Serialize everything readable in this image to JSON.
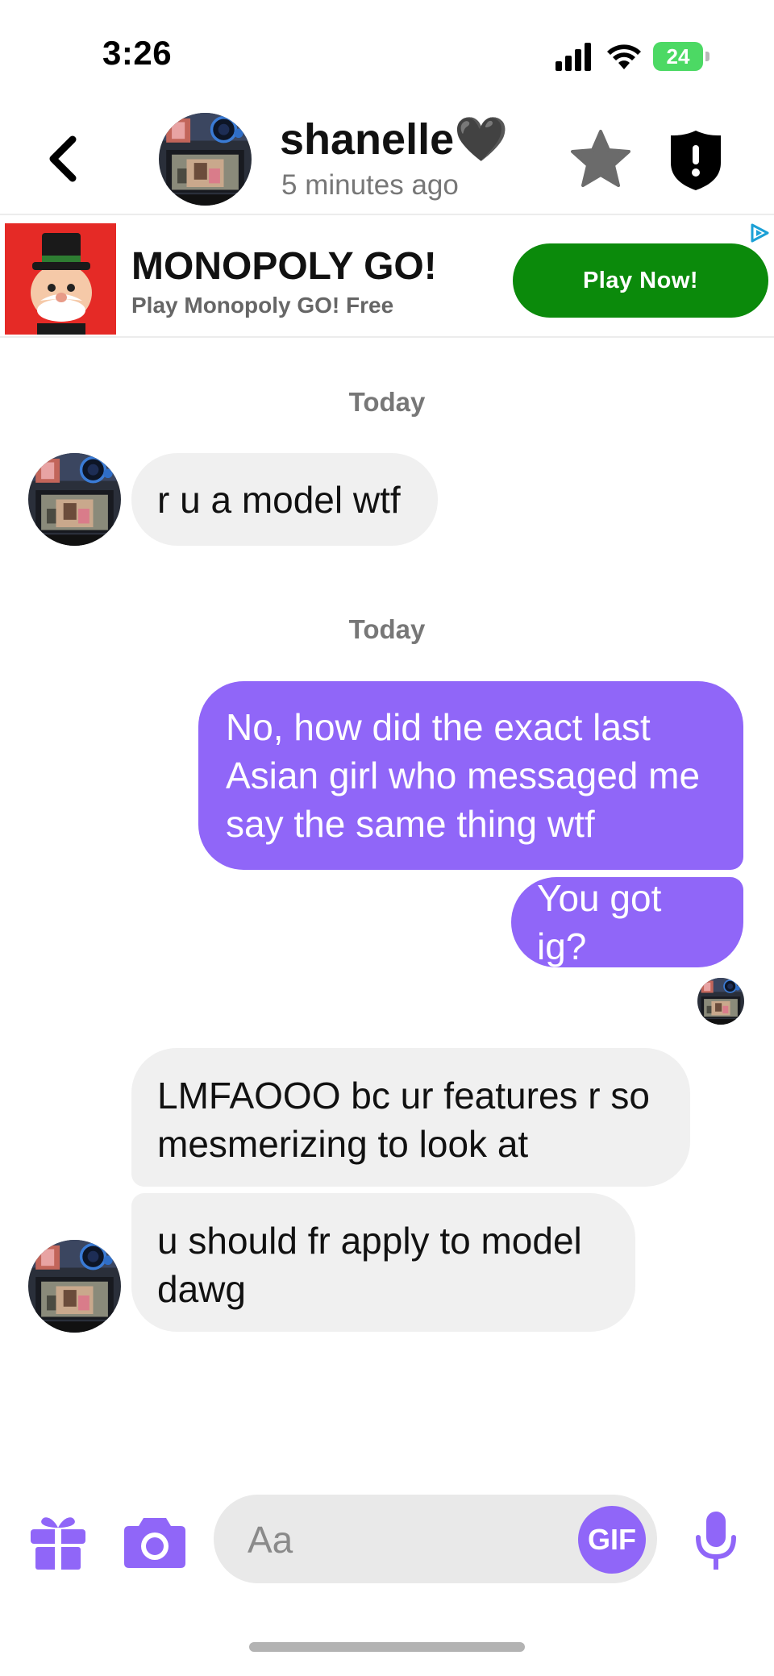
{
  "status_bar": {
    "time": "3:26",
    "battery": "24"
  },
  "header": {
    "contact_name": "shanelle🖤",
    "last_seen": "5 minutes ago"
  },
  "ad": {
    "title": "MONOPOLY GO!",
    "subtitle": "Play Monopoly GO! Free",
    "cta": "Play Now!"
  },
  "chat": {
    "day_labels": [
      "Today",
      "Today"
    ],
    "messages": [
      {
        "direction": "incoming",
        "text": "r u a model wtf"
      },
      {
        "direction": "outgoing",
        "text": "No, how did the exact last Asian girl who messaged me say the same thing wtf"
      },
      {
        "direction": "outgoing",
        "text": "You got ig?"
      },
      {
        "direction": "incoming",
        "text": "LMFAOOO bc ur features r so mesmerizing to look at"
      },
      {
        "direction": "incoming",
        "text": "u should fr apply to model dawg"
      }
    ]
  },
  "composer": {
    "placeholder": "Aa",
    "gif_label": "GIF"
  },
  "colors": {
    "accent": "#9066f8",
    "incoming_bubble": "#f0f0f0",
    "ad_cta": "#0b8a0b",
    "battery": "#4cd964"
  },
  "icons": [
    "back-chevron-icon",
    "star-icon",
    "shield-icon",
    "ad-choices-icon",
    "gift-icon",
    "camera-icon",
    "microphone-icon",
    "signal-icon",
    "wifi-icon"
  ]
}
